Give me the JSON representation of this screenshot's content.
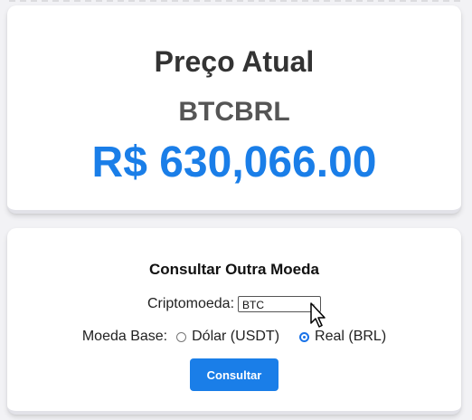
{
  "price_card": {
    "title": "Preço Atual",
    "pair": "BTCBRL",
    "price": "R$ 630,066.00"
  },
  "query_card": {
    "heading": "Consultar Outra Moeda",
    "crypto_label": "Criptomoeda:",
    "crypto_selected": "BTC",
    "base_label": "Moeda Base:",
    "options": [
      {
        "label": "Dólar (USDT)",
        "checked": false
      },
      {
        "label": "Real (BRL)",
        "checked": true
      }
    ],
    "submit_label": "Consultar"
  },
  "colors": {
    "accent": "#1a7ee8",
    "title_text": "#333333"
  },
  "icons": {
    "select_chevron": "chevron-down-icon",
    "cursor": "mouse-pointer-icon"
  }
}
